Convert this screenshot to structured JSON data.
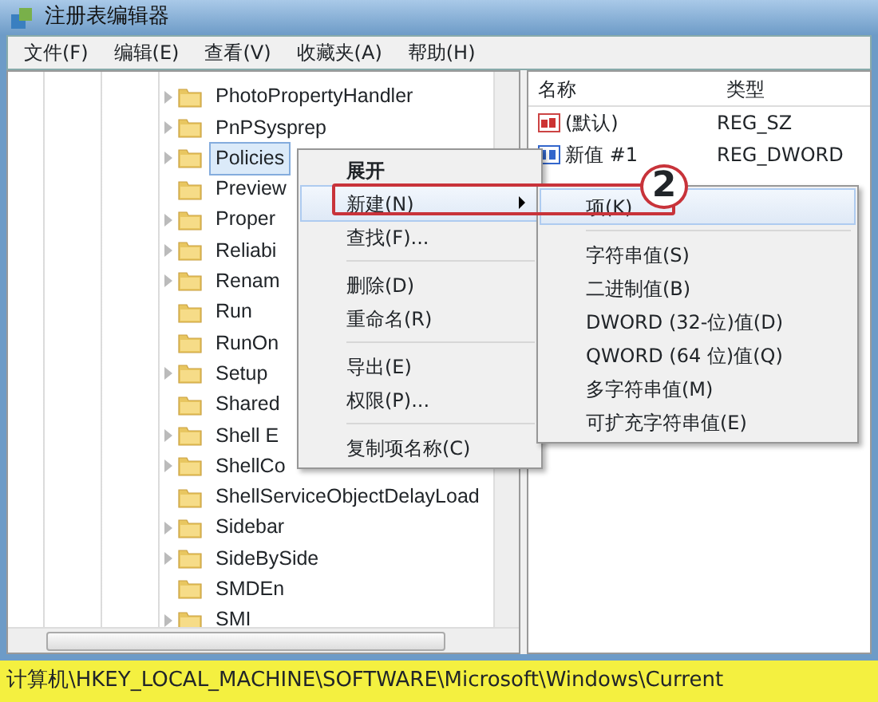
{
  "window": {
    "title": "注册表编辑器"
  },
  "menu_bar": [
    "文件(F)",
    "编辑(E)",
    "查看(V)",
    "收藏夹(A)",
    "帮助(H)"
  ],
  "tree": {
    "items": [
      {
        "label": "PhotoPropertyHandler",
        "expandable": true,
        "selected": false
      },
      {
        "label": "PnPSysprep",
        "expandable": true,
        "selected": false
      },
      {
        "label": "Policies",
        "expandable": true,
        "selected": true
      },
      {
        "label": "Preview",
        "expandable": false,
        "selected": false
      },
      {
        "label": "Proper",
        "expandable": true,
        "selected": false
      },
      {
        "label": "Reliabi",
        "expandable": true,
        "selected": false
      },
      {
        "label": "Renam",
        "expandable": true,
        "selected": false
      },
      {
        "label": "Run",
        "expandable": false,
        "selected": false
      },
      {
        "label": "RunOn",
        "expandable": false,
        "selected": false
      },
      {
        "label": "Setup",
        "expandable": true,
        "selected": false
      },
      {
        "label": "Shared",
        "expandable": false,
        "selected": false
      },
      {
        "label": "Shell E",
        "expandable": true,
        "selected": false
      },
      {
        "label": "ShellCo",
        "expandable": true,
        "selected": false
      },
      {
        "label": "ShellServiceObjectDelayLoad",
        "expandable": false,
        "selected": false
      },
      {
        "label": "Sidebar",
        "expandable": true,
        "selected": false
      },
      {
        "label": "SideBySide",
        "expandable": true,
        "selected": false
      },
      {
        "label": "SMDEn",
        "expandable": false,
        "selected": false
      },
      {
        "label": "SMI",
        "expandable": true,
        "selected": false
      }
    ]
  },
  "values": {
    "columns": [
      "名称",
      "类型"
    ],
    "rows": [
      {
        "name": "(默认)",
        "type": "REG_SZ",
        "kind": "string"
      },
      {
        "name": "新值 #1",
        "type": "REG_DWORD",
        "kind": "number"
      }
    ]
  },
  "context_menu": {
    "items": [
      {
        "kind": "default",
        "label": "展开"
      },
      {
        "kind": "submenu",
        "label": "新建(N)",
        "highlighted": true
      },
      {
        "kind": "item",
        "label": "查找(F)..."
      },
      {
        "kind": "separator"
      },
      {
        "kind": "item",
        "label": "删除(D)"
      },
      {
        "kind": "item",
        "label": "重命名(R)"
      },
      {
        "kind": "separator"
      },
      {
        "kind": "item",
        "label": "导出(E)"
      },
      {
        "kind": "item",
        "label": "权限(P)..."
      },
      {
        "kind": "separator"
      },
      {
        "kind": "item",
        "label": "复制项名称(C)"
      }
    ]
  },
  "submenu": {
    "items": [
      {
        "kind": "item",
        "label": "项(K)",
        "highlighted": true
      },
      {
        "kind": "separator"
      },
      {
        "kind": "item",
        "label": "字符串值(S)"
      },
      {
        "kind": "item",
        "label": "二进制值(B)"
      },
      {
        "kind": "item",
        "label": "DWORD (32-位)值(D)"
      },
      {
        "kind": "item",
        "label": "QWORD (64 位)值(Q)"
      },
      {
        "kind": "item",
        "label": "多字符串值(M)"
      },
      {
        "kind": "item",
        "label": "可扩充字符串值(E)"
      }
    ]
  },
  "callout": {
    "label": "2"
  },
  "status_bar": {
    "path": "计算机\\HKEY_LOCAL_MACHINE\\SOFTWARE\\Microsoft\\Windows\\Current"
  }
}
